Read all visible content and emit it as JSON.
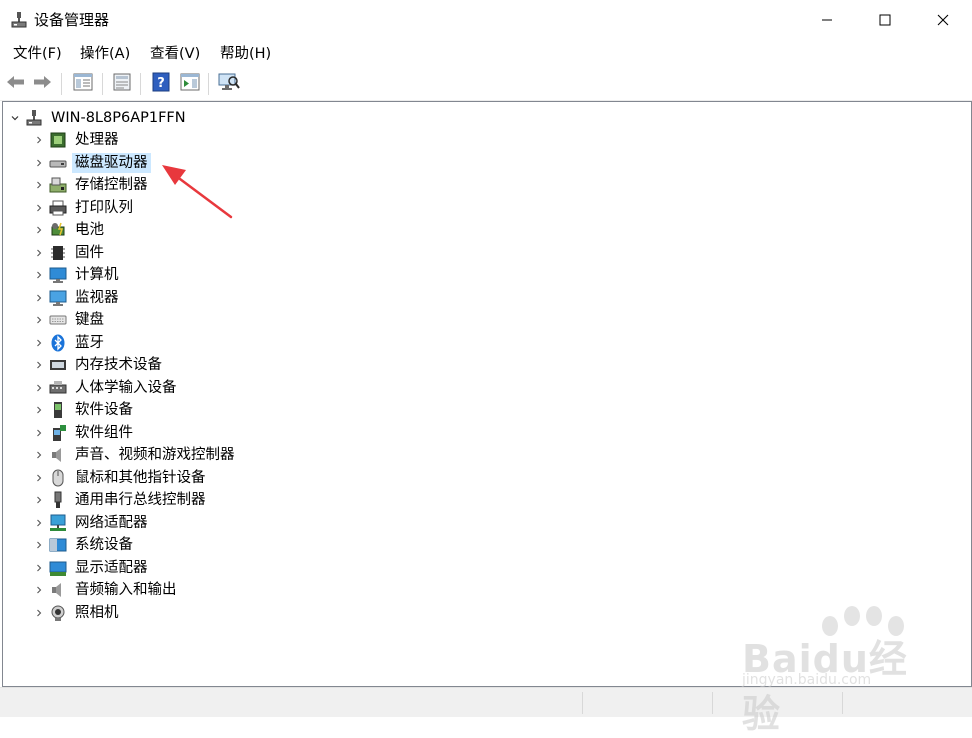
{
  "window": {
    "title": "设备管理器",
    "controls": [
      "minimize-icon",
      "maximize-icon",
      "close-icon"
    ]
  },
  "menu": [
    "文件(F)",
    "操作(A)",
    "查看(V)",
    "帮助(H)"
  ],
  "toolbar": {
    "buttons": [
      "back-arrow-icon",
      "forward-arrow-icon",
      "show-hide-tree-icon",
      "properties-icon",
      "help-icon",
      "action-pane-icon",
      "scan-hardware-icon"
    ]
  },
  "tree": {
    "root": {
      "label": "WIN-8L8P6AP1FFN",
      "expanded": true,
      "icon": "computer-root-icon"
    },
    "selected_index": 1,
    "children": [
      {
        "label": "处理器",
        "icon": "cpu-icon"
      },
      {
        "label": "磁盘驱动器",
        "icon": "disk-drive-icon"
      },
      {
        "label": "存储控制器",
        "icon": "storage-controller-icon"
      },
      {
        "label": "打印队列",
        "icon": "printer-icon"
      },
      {
        "label": "电池",
        "icon": "battery-icon"
      },
      {
        "label": "固件",
        "icon": "firmware-icon"
      },
      {
        "label": "计算机",
        "icon": "computer-icon"
      },
      {
        "label": "监视器",
        "icon": "monitor-icon"
      },
      {
        "label": "键盘",
        "icon": "keyboard-icon"
      },
      {
        "label": "蓝牙",
        "icon": "bluetooth-icon"
      },
      {
        "label": "内存技术设备",
        "icon": "memory-device-icon"
      },
      {
        "label": "人体学输入设备",
        "icon": "hid-icon"
      },
      {
        "label": "软件设备",
        "icon": "software-device-icon"
      },
      {
        "label": "软件组件",
        "icon": "software-component-icon"
      },
      {
        "label": "声音、视频和游戏控制器",
        "icon": "sound-icon"
      },
      {
        "label": "鼠标和其他指针设备",
        "icon": "mouse-icon"
      },
      {
        "label": "通用串行总线控制器",
        "icon": "usb-icon"
      },
      {
        "label": "网络适配器",
        "icon": "network-adapter-icon"
      },
      {
        "label": "系统设备",
        "icon": "system-device-icon"
      },
      {
        "label": "显示适配器",
        "icon": "display-adapter-icon"
      },
      {
        "label": "音频输入和输出",
        "icon": "audio-io-icon"
      },
      {
        "label": "照相机",
        "icon": "camera-icon"
      }
    ]
  },
  "annotation": {
    "color": "#e8383d",
    "target": "磁盘驱动器"
  },
  "watermark": {
    "text": "Baidu经验",
    "sub": "jingyan.baidu.com"
  },
  "colors": {
    "selection": "#cce8ff",
    "status_bar": "#f0f0f0",
    "accent": "#0078d7"
  }
}
